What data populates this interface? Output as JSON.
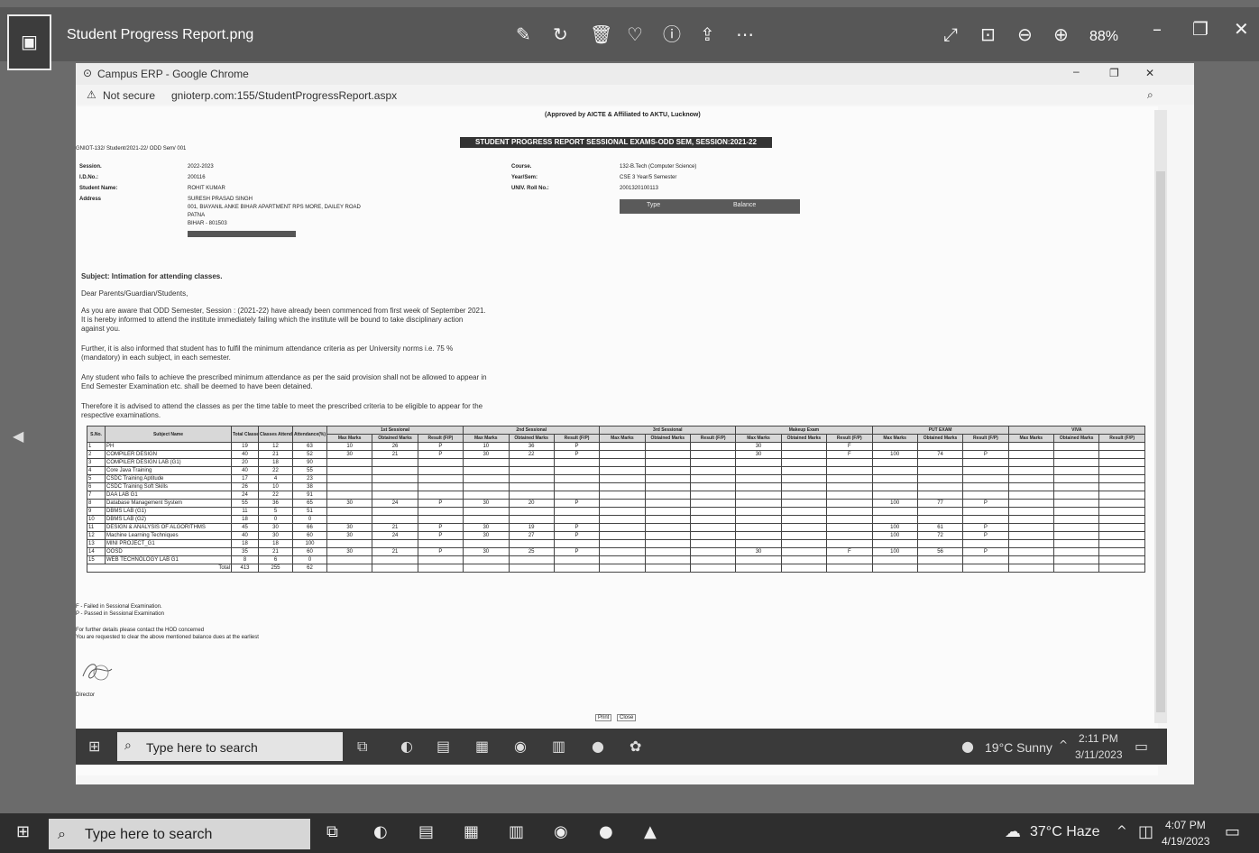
{
  "viewer": {
    "title": "Student Progress Report.png",
    "zoom": "88%",
    "icons": [
      "edit-image-icon",
      "rotate-icon",
      "delete-icon",
      "favorite-icon",
      "info-icon",
      "share-icon",
      "more-icon",
      "expand-icon",
      "actual-size-icon",
      "zoom-out-icon",
      "zoom-in-icon",
      "minimize-icon",
      "restore-icon",
      "close-icon"
    ]
  },
  "chrome": {
    "title": "Campus ERP - Google Chrome",
    "security": "Not secure",
    "url": "gnioterp.com:155/StudentProgressReport.aspx"
  },
  "report": {
    "approval": "(Approved by AICTE & Affiliated to AKTU, Lucknow)",
    "banner": "STUDENT PROGRESS REPORT SESSIONAL EXAMS-ODD SEM, SESSION:2021-22",
    "ref": "GNIOT-132/ Student/2021-22/ ODD Sem/ 001",
    "left_labels": [
      "Session.",
      "I.D.No.:",
      "Student Name:",
      "Address"
    ],
    "left_values": [
      "2022-2023",
      "200116",
      "ROHIT KUMAR"
    ],
    "address_lines": [
      "SURESH PRASAD SINGH",
      "001, BIAYANIL ANKE BIHAR APARTMENT RPS MORE, DAILEY ROAD",
      "PATNA",
      "BIHAR - 801503"
    ],
    "right_labels": [
      "Course.",
      "Year/Sem:",
      "UNIV. Roll No.:"
    ],
    "right_values": [
      "132-B.Tech (Computer Science)",
      "CSE 3 Year/5 Semester",
      "2001320100113"
    ],
    "type_label": "Type",
    "balance_label": "Balance",
    "subject": "Subject: Intimation for attending classes.",
    "salutation": "Dear Parents/Guardian/Students,",
    "para1": "As you are aware that ODD Semester, Session : (2021-22) have already been commenced from first week of September 2021. It is hereby informed to attend the institute immediately failing which the institute will be bound to take disciplinary action against you.",
    "para2": "Further, it is also informed that student has to fulfil the minimum attendance criteria as per University norms i.e. 75 % (mandatory) in each subject, in each semester.",
    "para3": "Any student who fails to achieve the prescribed minimum attendance as per the said provision shall not be allowed to appear in End Semester Examination etc. shall be deemed to have been detained.",
    "para4": "Therefore it is advised to attend the classes as per the time table to meet the prescribed criteria to be eligible to appear for the respective examinations.",
    "groups": [
      "1st Sessional",
      "2nd Sessional",
      "3rd Sessional",
      "Makeup Exam",
      "PUT EXAM",
      "VIVA"
    ],
    "sub_headers": [
      "Max Marks",
      "Obtained Marks",
      "Result (F/P)"
    ],
    "col_headers": [
      "S.No.",
      "Subject Name",
      "Total Classes",
      "Classes Attended",
      "Attendance(%)"
    ],
    "rows": [
      [
        "1",
        "PH",
        "19",
        "12",
        "63",
        "10",
        "26",
        "P",
        "10",
        "36",
        "P",
        "",
        "",
        "",
        "30",
        "",
        "F",
        "",
        "",
        "",
        "",
        "",
        ""
      ],
      [
        "2",
        "COMPILER DESIGN",
        "40",
        "21",
        "52",
        "30",
        "21",
        "P",
        "30",
        "22",
        "P",
        "",
        "",
        "",
        "30",
        "",
        "F",
        "100",
        "74",
        "P",
        "",
        "",
        ""
      ],
      [
        "3",
        "COMPILER DESIGN LAB (G1)",
        "20",
        "18",
        "90",
        "",
        "",
        "",
        "",
        "",
        "",
        "",
        "",
        "",
        "",
        "",
        "",
        "",
        "",
        "",
        "",
        "",
        ""
      ],
      [
        "4",
        "Core Java Training",
        "40",
        "22",
        "55",
        "",
        "",
        "",
        "",
        "",
        "",
        "",
        "",
        "",
        "",
        "",
        "",
        "",
        "",
        "",
        "",
        "",
        ""
      ],
      [
        "5",
        "CSDC Training Aptitude",
        "17",
        "4",
        "23",
        "",
        "",
        "",
        "",
        "",
        "",
        "",
        "",
        "",
        "",
        "",
        "",
        "",
        "",
        "",
        "",
        "",
        ""
      ],
      [
        "6",
        "CSDC Training Soft Skills",
        "26",
        "10",
        "38",
        "",
        "",
        "",
        "",
        "",
        "",
        "",
        "",
        "",
        "",
        "",
        "",
        "",
        "",
        "",
        "",
        "",
        ""
      ],
      [
        "7",
        "DAA LAB G1",
        "24",
        "22",
        "91",
        "",
        "",
        "",
        "",
        "",
        "",
        "",
        "",
        "",
        "",
        "",
        "",
        "",
        "",
        "",
        "",
        "",
        ""
      ],
      [
        "8",
        "Database Management System",
        "55",
        "36",
        "65",
        "30",
        "24",
        "P",
        "30",
        "20",
        "P",
        "",
        "",
        "",
        "",
        "",
        "",
        "100",
        "77",
        "P",
        "",
        "",
        ""
      ],
      [
        "9",
        "DBMS LAB (G1)",
        "11",
        "5",
        "51",
        "",
        "",
        "",
        "",
        "",
        "",
        "",
        "",
        "",
        "",
        "",
        "",
        "",
        "",
        "",
        "",
        "",
        ""
      ],
      [
        "10",
        "DBMS LAB (G2)",
        "18",
        "0",
        "0",
        "",
        "",
        "",
        "",
        "",
        "",
        "",
        "",
        "",
        "",
        "",
        "",
        "",
        "",
        "",
        "",
        "",
        ""
      ],
      [
        "11",
        "DESIGN & ANALYSIS OF ALGORITHMS",
        "45",
        "30",
        "66",
        "30",
        "21",
        "P",
        "30",
        "19",
        "P",
        "",
        "",
        "",
        "",
        "",
        "",
        "100",
        "61",
        "P",
        "",
        "",
        ""
      ],
      [
        "12",
        "Machine Learning Techniques",
        "40",
        "30",
        "60",
        "30",
        "24",
        "P",
        "30",
        "27",
        "P",
        "",
        "",
        "",
        "",
        "",
        "",
        "100",
        "72",
        "P",
        "",
        "",
        ""
      ],
      [
        "13",
        "MINI PROJECT_G1",
        "18",
        "18",
        "100",
        "",
        "",
        "",
        "",
        "",
        "",
        "",
        "",
        "",
        "",
        "",
        "",
        "",
        "",
        "",
        "",
        "",
        ""
      ],
      [
        "14",
        "OOSD",
        "35",
        "21",
        "60",
        "30",
        "21",
        "P",
        "30",
        "25",
        "P",
        "",
        "",
        "",
        "30",
        "",
        "F",
        "100",
        "56",
        "P",
        "",
        "",
        ""
      ],
      [
        "15",
        "WEB TECHNOLOGY LAB G1",
        "8",
        "6",
        "0",
        "",
        "",
        "",
        "",
        "",
        "",
        "",
        "",
        "",
        "",
        "",
        "",
        "",
        "",
        "",
        "",
        "",
        ""
      ]
    ],
    "total_label": "Total",
    "totals": [
      "413",
      "255",
      "62"
    ],
    "legend_f": "F - Failed in Sessional Examination.",
    "legend_p": "P - Passed in Sessional Examination",
    "note1": "For further details please contact the HOD concerned",
    "note2": "You are requested to clear the above mentioned balance dues at the earliest",
    "signatory": "Director",
    "print_label": "Print",
    "close_label": "Close"
  },
  "inner_taskbar": {
    "search_placeholder": "Type here to search",
    "weather": "19°C Sunny",
    "time": "2:11 PM",
    "date": "3/11/2023"
  },
  "outer_taskbar": {
    "search_placeholder": "Type here to search",
    "weather": "37°C Haze",
    "time": "4:07 PM",
    "date": "4/19/2023"
  }
}
